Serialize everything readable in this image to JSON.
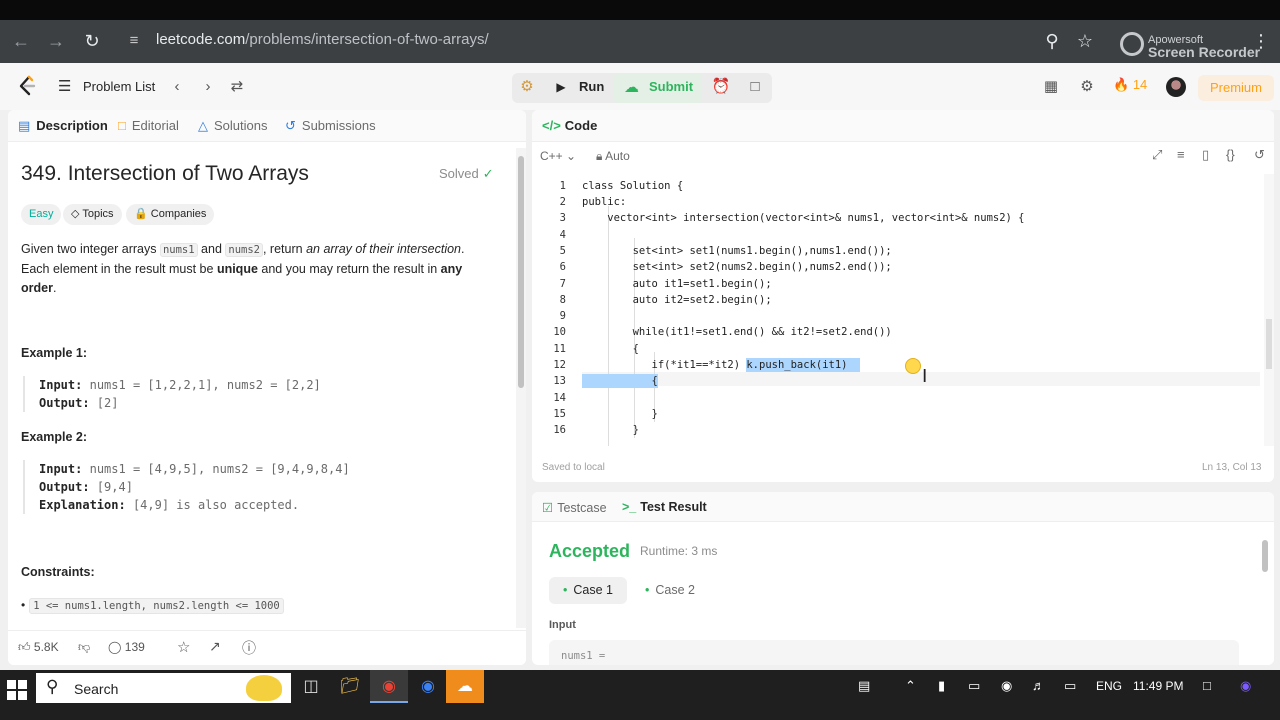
{
  "browser": {
    "url_host": "leetcode.com",
    "url_path": "/problems/intersection-of-two-arrays/",
    "watermark_line1": "Apowersoft",
    "watermark_line2": "Screen Recorder"
  },
  "header": {
    "problem_list": "Problem List",
    "run": "Run",
    "submit": "Submit",
    "streak": "14",
    "premium": "Premium"
  },
  "left_tabs": [
    {
      "label": "Description",
      "icon": "description-icon"
    },
    {
      "label": "Editorial",
      "icon": "book-icon"
    },
    {
      "label": "Solutions",
      "icon": "flask-icon"
    },
    {
      "label": "Submissions",
      "icon": "history-icon"
    }
  ],
  "problem": {
    "title": "349. Intersection of Two Arrays",
    "status": "Solved",
    "difficulty": "Easy",
    "topics": "Topics",
    "companies": "Companies",
    "desc_1": "Given two integer arrays ",
    "code_nums1": "nums1",
    "desc_and": " and ",
    "code_nums2": "nums2",
    "desc_2": ", return ",
    "desc_em": "an array of their intersection",
    "desc_3": ". Each element in the result must be ",
    "desc_unique": "unique",
    "desc_4": " and you may return the result in ",
    "desc_any": "any order",
    "desc_5": ".",
    "example1_heading": "Example 1:",
    "example1_input_label": "Input:",
    "example1_input": "nums1 = [1,2,2,1], nums2 = [2,2]",
    "example1_output_label": "Output:",
    "example1_output": "[2]",
    "example2_heading": "Example 2:",
    "example2_input_label": "Input:",
    "example2_input": "nums1 = [4,9,5], nums2 = [9,4,9,8,4]",
    "example2_output_label": "Output:",
    "example2_output": "[9,4]",
    "example2_expl_label": "Explanation:",
    "example2_expl": "[4,9] is also accepted.",
    "constraints_heading": "Constraints:",
    "constraint_1": "1 <= nums1.length, nums2.length <= 1000"
  },
  "footer": {
    "likes": "5.8K",
    "comments": "139"
  },
  "code": {
    "panel_title": "Code",
    "language": "C++",
    "mode": "Auto",
    "saved": "Saved to local",
    "position": "Ln 13, Col 13",
    "lines": [
      "class Solution {",
      "public:",
      "    vector<int> intersection(vector<int>& nums1, vector<int>& nums2) {",
      "",
      "        set<int> set1(nums1.begin(),nums1.end());",
      "        set<int> set2(nums2.begin(),nums2.end());",
      "        auto it1=set1.begin();",
      "        auto it2=set2.begin();",
      "",
      "        while(it1!=set1.end() && it2!=set2.end())",
      "        {",
      "           if(*it1==*it2) k.push_back(it1)",
      "           {",
      "",
      "           }",
      "        }"
    ],
    "line_numbers": [
      "1",
      "2",
      "3",
      "4",
      "5",
      "6",
      "7",
      "8",
      "9",
      "10",
      "11",
      "12",
      "13",
      "14",
      "15",
      "16"
    ]
  },
  "result": {
    "tab_testcase": "Testcase",
    "tab_result": "Test Result",
    "status": "Accepted",
    "runtime": "Runtime: 3 ms",
    "case1": "Case 1",
    "case2": "Case 2",
    "input_label": "Input",
    "input_value": "nums1 ="
  },
  "taskbar": {
    "search": "Search",
    "lang": "ENG",
    "time": "11:49 PM"
  }
}
